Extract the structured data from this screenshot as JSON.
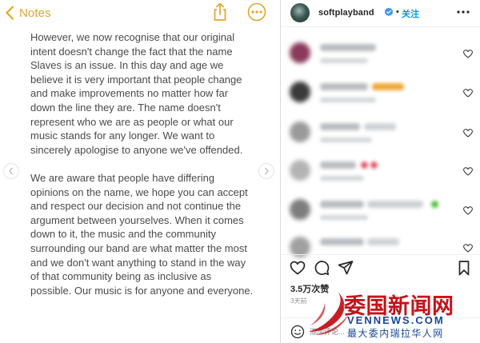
{
  "notes": {
    "back_label": "Notes",
    "paragraphs": [
      "However, we now recognise that our original intent doesn't change the fact that the name Slaves is an issue. In this day and age we believe it is very important that people change and make improvements no matter how far down the line they are. The name doesn't represent who we are as people or what our music stands for any longer. We want to sincerely apologise to anyone we've offended.",
      "We are aware that people have differing opinions on the name, we hope you can accept and respect our decision and not continue the argument between yourselves. When it comes down to it, the music and the community surrounding our band are what matter the most and we don't want anything to stand in the way of that community being as inclusive as possible. Our music is for anyone and everyone."
    ]
  },
  "instagram": {
    "username": "softplayband",
    "separator": "•",
    "follow_label": "关注",
    "likes": "3.5万次赞",
    "time": "3天前",
    "comment_placeholder": "添加评论..."
  },
  "watermark": {
    "name_cn": "委国新闻网",
    "name_en": "VENNEWS.COM",
    "tagline_cn": "最大委内瑞拉华人网"
  },
  "colors": {
    "notes_accent": "#e2a52c",
    "ig_link": "#0095f6",
    "watermark_red": "#c3121b",
    "watermark_blue": "#16469b"
  },
  "icons": {
    "notes": [
      "chevron-left-icon",
      "share-icon",
      "more-circle-icon",
      "carousel-prev-icon",
      "carousel-next-icon"
    ],
    "instagram": [
      "verified-badge-icon",
      "more-horizontal-icon",
      "heart-icon",
      "comment-icon",
      "send-icon",
      "bookmark-icon",
      "emoji-icon"
    ]
  }
}
